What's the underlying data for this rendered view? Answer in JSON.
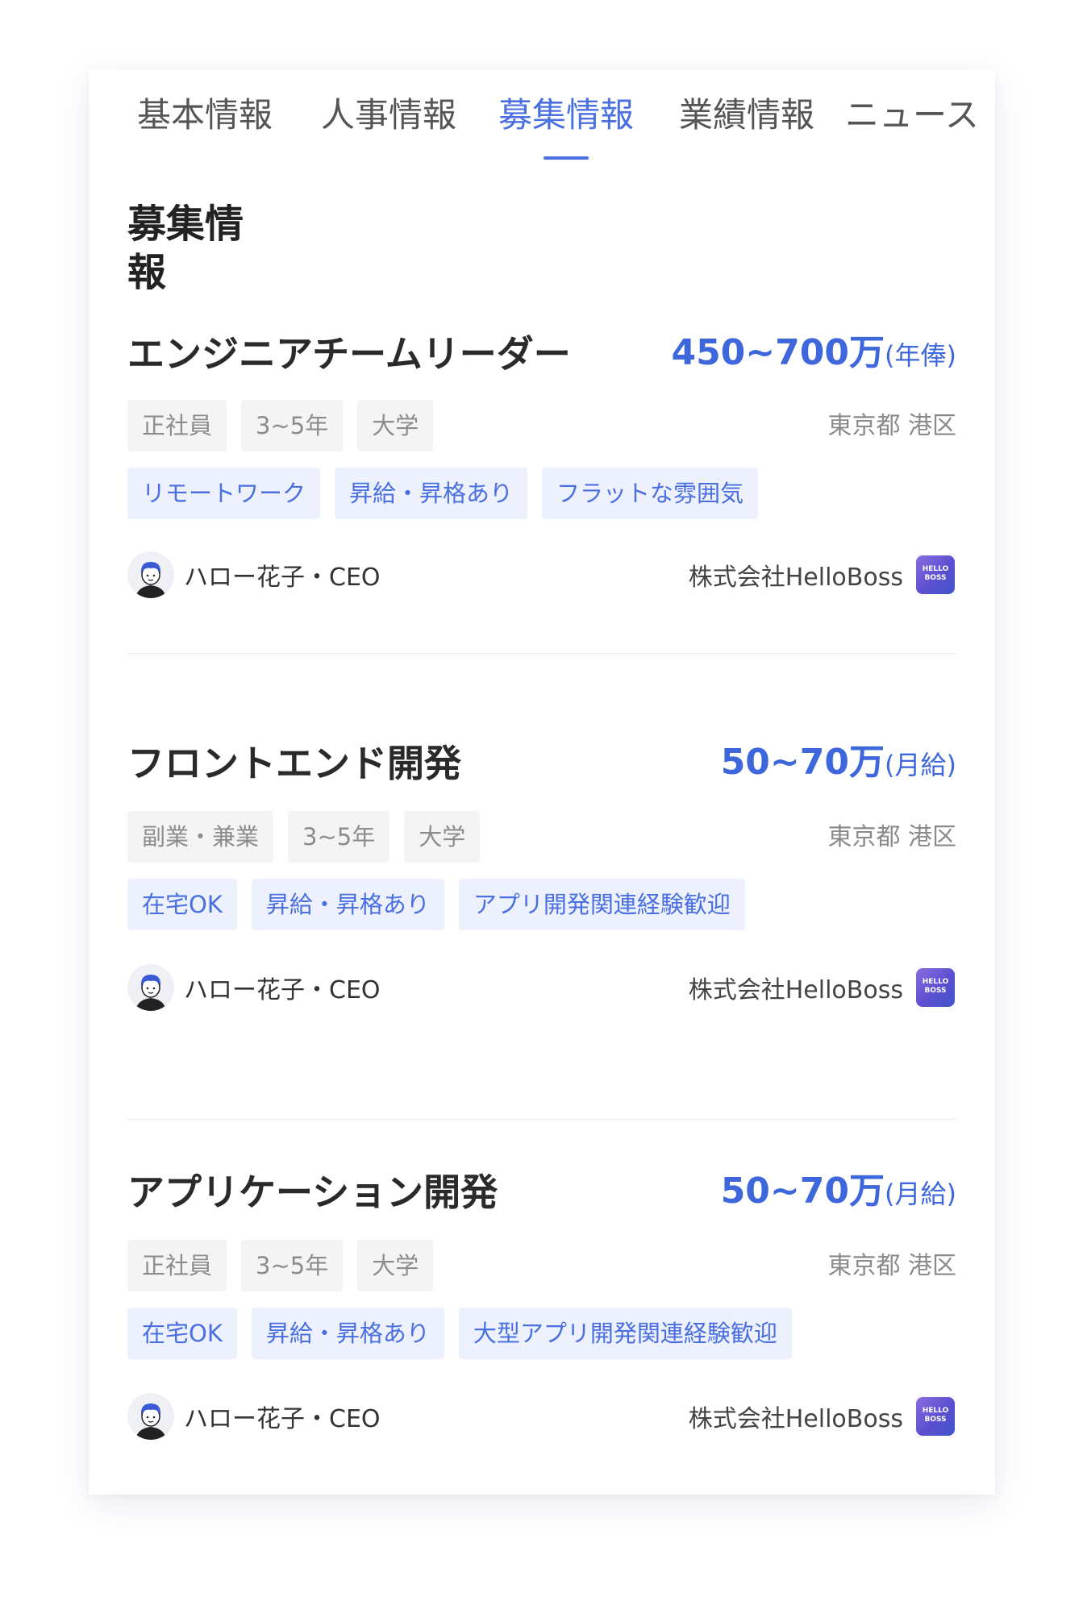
{
  "tabs": [
    {
      "label": "基本情報"
    },
    {
      "label": "人事情報"
    },
    {
      "label": "募集情報",
      "active": true
    },
    {
      "label": "業績情報"
    },
    {
      "label": "ニュース"
    }
  ],
  "section_title": "募集情報",
  "jobs": [
    {
      "title": "エンジニアチームリーダー",
      "salary_amount": "450~700万",
      "salary_period": "(年俸)",
      "tags_gray": [
        "正社員",
        "3~5年",
        "大学"
      ],
      "location": "東京都 港区",
      "tags_blue": [
        "リモートワーク",
        "昇給・昇格あり",
        "フラットな雰囲気"
      ],
      "recruiter": "ハロー花子・CEO",
      "company": "株式会社HelloBoss"
    },
    {
      "title": "フロントエンド開発",
      "salary_amount": "50~70万",
      "salary_period": "(月給)",
      "tags_gray": [
        "副業・兼業",
        "3~5年",
        "大学"
      ],
      "location": "東京都 港区",
      "tags_blue": [
        "在宅OK",
        "昇給・昇格あり",
        "アプリ開発関連経験歓迎"
      ],
      "recruiter": "ハロー花子・CEO",
      "company": "株式会社HelloBoss"
    },
    {
      "title": "アプリケーション開発",
      "salary_amount": "50~70万",
      "salary_period": "(月給)",
      "tags_gray": [
        "正社員",
        "3~5年",
        "大学"
      ],
      "location": "東京都 港区",
      "tags_blue": [
        "在宅OK",
        "昇給・昇格あり",
        "大型アプリ開発関連経験歓迎"
      ],
      "recruiter": "ハロー花子・CEO",
      "company": "株式会社HelloBoss"
    }
  ],
  "logo_text": [
    "HELLO",
    "BOSS"
  ],
  "colors": {
    "accent": "#4a6fe0",
    "salary": "#3f67dc",
    "tag_gray_bg": "#f4f4f4",
    "tag_blue_bg": "#edf1fd"
  }
}
